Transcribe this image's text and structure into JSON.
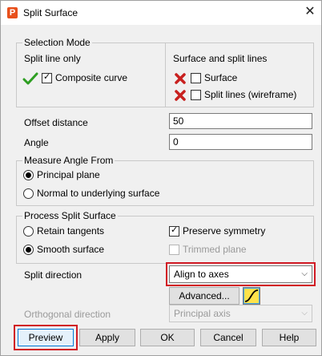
{
  "window": {
    "title": "Split Surface",
    "app_icon_letter": "P",
    "close_glyph": "✕"
  },
  "selection_mode": {
    "group_label": "Selection Mode",
    "left_heading": "Split line only",
    "right_heading": "Surface and split lines",
    "composite_curve": {
      "label": "Composite curve",
      "checked": true
    },
    "surface": {
      "label": "Surface",
      "checked": false
    },
    "split_lines": {
      "label": "Split lines (wireframe)",
      "checked": false
    }
  },
  "offset_distance": {
    "label": "Offset distance",
    "value": "50"
  },
  "angle": {
    "label": "Angle",
    "value": "0"
  },
  "measure_angle": {
    "group_label": "Measure Angle From",
    "options": [
      "Principal plane",
      "Normal to underlying surface"
    ],
    "selected": 0
  },
  "process_split": {
    "group_label": "Process Split Surface",
    "retain_tangents": "Retain tangents",
    "smooth_surface": "Smooth surface",
    "selected": "Smooth surface",
    "preserve_symmetry": {
      "label": "Preserve symmetry",
      "checked": true
    },
    "trimmed_plane": {
      "label": "Trimmed plane",
      "checked": false,
      "disabled": true
    }
  },
  "split_direction": {
    "label": "Split direction",
    "value": "Align to axes",
    "advanced_label": "Advanced..."
  },
  "orthogonal_direction": {
    "label": "Orthogonal direction",
    "value": "Principal axis",
    "disabled": true
  },
  "buttons": {
    "preview": "Preview",
    "apply": "Apply",
    "ok": "OK",
    "cancel": "Cancel",
    "help": "Help"
  },
  "colors": {
    "highlight": "#d11a24",
    "check_green": "#2e9e22",
    "cross_red": "#c8201f"
  }
}
